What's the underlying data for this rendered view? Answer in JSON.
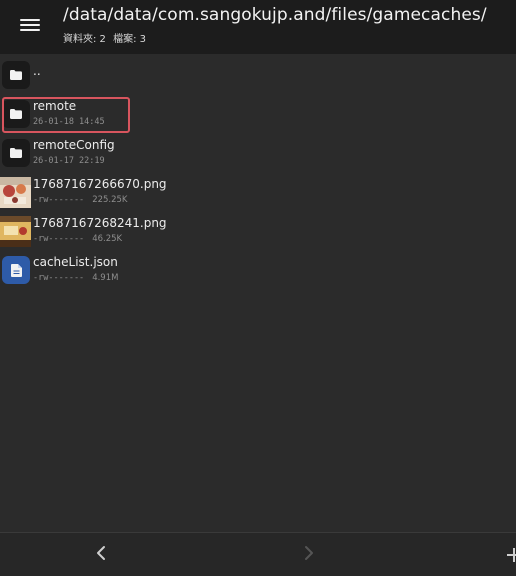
{
  "header": {
    "path": "/data/data/com.sangokujp.and/files/gamecaches/",
    "folder_count": "資料夾: 2",
    "file_count": "檔案: 3"
  },
  "files": [
    {
      "name": "..",
      "date": "",
      "perms": "",
      "size": "",
      "icon": "folder-icon"
    },
    {
      "name": "remote",
      "date": "26-01-18 14:45",
      "perms": "",
      "size": "",
      "icon": "folder-icon"
    },
    {
      "name": "remoteConfig",
      "date": "26-01-17 22:19",
      "perms": "",
      "size": "",
      "icon": "folder-icon"
    },
    {
      "name": "17687167266670.png",
      "date": "",
      "perms": "-rw-------",
      "size": "225.25K",
      "icon": "image-thumbnail"
    },
    {
      "name": "17687167268241.png",
      "date": "",
      "perms": "-rw-------",
      "size": "46.25K",
      "icon": "image-thumbnail"
    },
    {
      "name": "cacheList.json",
      "date": "",
      "perms": "-rw-------",
      "size": "4.91M",
      "icon": "document-icon"
    }
  ],
  "colors": {
    "background": "#2b2b2b",
    "topbar": "#1c1c1c",
    "highlight": "#d8555e",
    "json_icon": "#2e5ba8"
  }
}
